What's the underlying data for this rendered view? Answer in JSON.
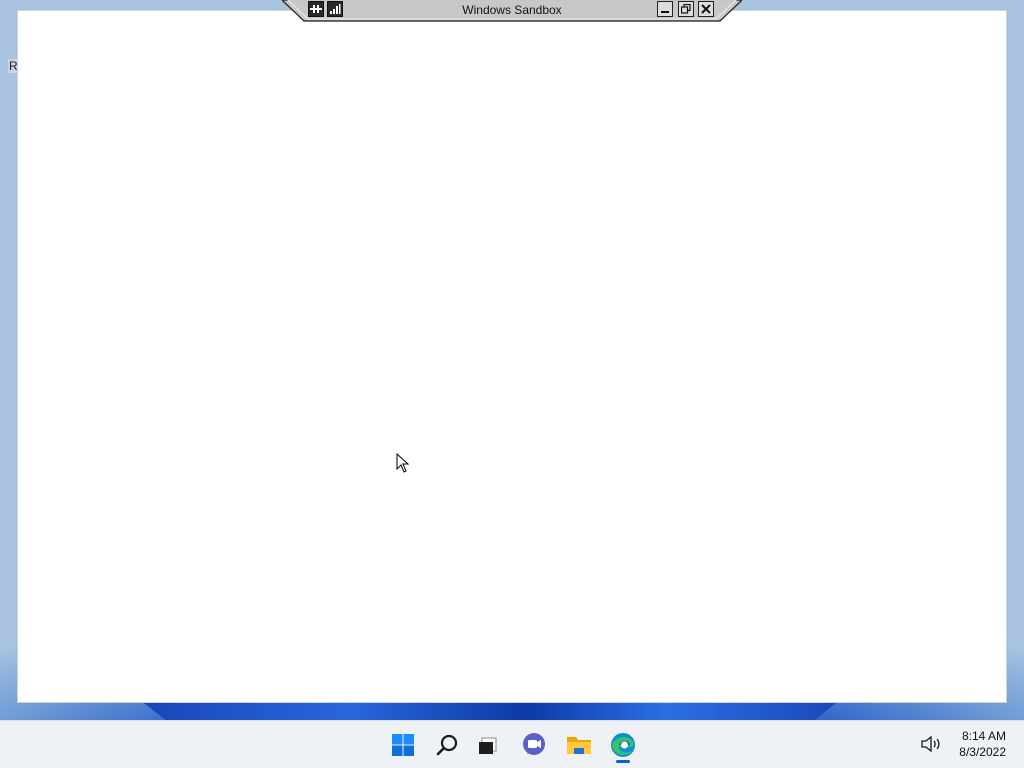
{
  "desktop": {
    "edge_label": "R"
  },
  "sandbox": {
    "title": "Windows Sandbox",
    "pin_icon": "pin-icon",
    "signal_icon": "connection-bars-icon",
    "minimize_icon": "minimize-icon",
    "restore_icon": "restore-icon",
    "close_icon": "close-icon"
  },
  "taskbar": {
    "items": [
      {
        "name": "start",
        "icon": "windows-logo-icon"
      },
      {
        "name": "search",
        "icon": "search-icon"
      },
      {
        "name": "task-view",
        "icon": "task-view-icon"
      },
      {
        "name": "chat",
        "icon": "teams-chat-icon"
      },
      {
        "name": "file-explorer",
        "icon": "folder-icon"
      },
      {
        "name": "edge",
        "icon": "edge-browser-icon",
        "active": true
      }
    ],
    "tray": {
      "volume_icon": "speaker-icon",
      "time": "8:14 AM",
      "date": "8/3/2022"
    }
  },
  "colors": {
    "taskbar_bg": "#eef1f6",
    "accent": "#0a64c8",
    "window_bg": "#ffffff",
    "connection_bar_bg": "#c8c8c8"
  }
}
